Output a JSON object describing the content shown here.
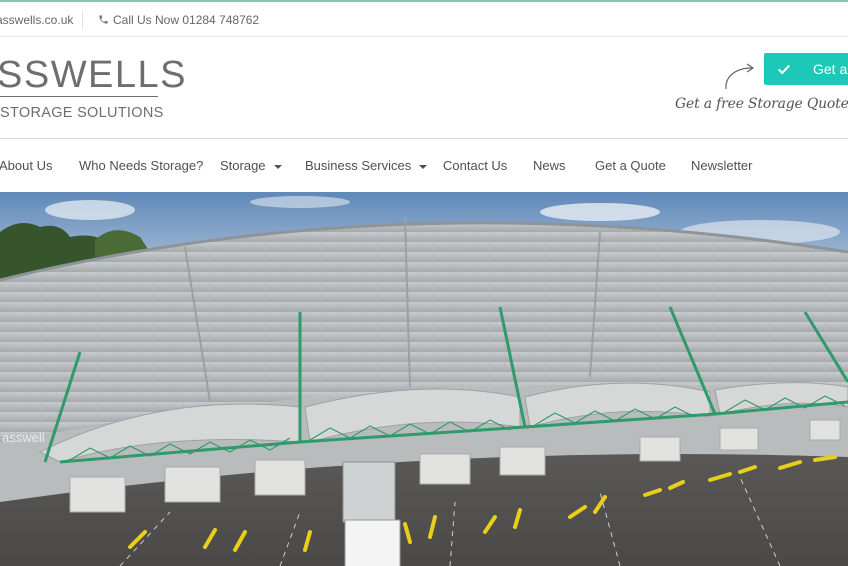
{
  "topbar": {
    "email": "asswells.co.uk",
    "phone_label": "Call Us Now 01284 748762",
    "phone_icon": "phone-icon"
  },
  "logo": {
    "main": "SSWELLS",
    "sub": "STORAGE SOLUTIONS"
  },
  "cta": {
    "button_label": "Get a",
    "button_icon": "check-icon",
    "script_text": "Get a free Storage Quote",
    "accent_color": "#1ec8b8"
  },
  "nav": {
    "items": [
      {
        "label": "About Us"
      },
      {
        "label": "Who Needs Storage?"
      },
      {
        "label": "Storage"
      },
      {
        "label": "Business Services"
      },
      {
        "label": "Contact Us"
      },
      {
        "label": "News"
      },
      {
        "label": "Get a Quote"
      },
      {
        "label": "Newsletter"
      }
    ]
  },
  "hero": {
    "building_sign": "asswell",
    "image_subject": "aerial view of storage warehouse"
  }
}
